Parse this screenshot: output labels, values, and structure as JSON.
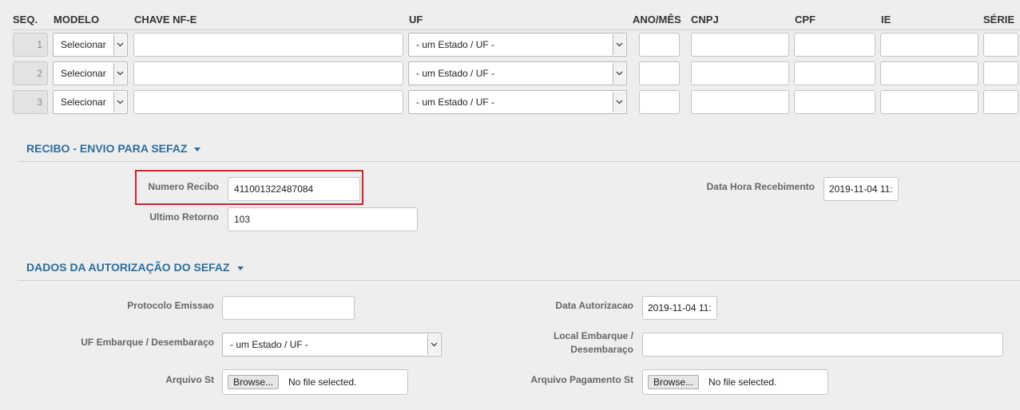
{
  "columns": {
    "seq": "SEQ.",
    "modelo": "MODELO",
    "chave": "CHAVE NF-E",
    "uf": "UF",
    "anomes": "ANO/MÊS",
    "cnpj": "CNPJ",
    "cpf": "CPF",
    "ie": "IE",
    "serie": "SÉRIE"
  },
  "rows": [
    {
      "seq": "1",
      "modelo": "Selecionar",
      "uf": "- um Estado / UF -"
    },
    {
      "seq": "2",
      "modelo": "Selecionar",
      "uf": "- um Estado / UF -"
    },
    {
      "seq": "3",
      "modelo": "Selecionar",
      "uf": "- um Estado / UF -"
    }
  ],
  "recibo": {
    "title": "RECIBO - ENVIO PARA SEFAZ",
    "numero_label": "Numero Recibo",
    "numero_value": "411001322487084",
    "ultimo_label": "Ultimo Retorno",
    "ultimo_value": "103",
    "data_label": "Data Hora Recebimento",
    "data_value": "2019-11-04 11:"
  },
  "autorizacao": {
    "title": "DADOS DA AUTORIZAÇÃO DO SEFAZ",
    "protocolo_label": "Protocolo Emissao",
    "protocolo_value": "",
    "data_label": "Data Autorizacao",
    "data_value": "2019-11-04 11:",
    "uf_label": "UF Embarque / Desembaraço",
    "uf_value": "- um Estado / UF -",
    "local_label_line1": "Local Embarque /",
    "local_label_line2": "Desembaraço",
    "local_value": "",
    "arquivo_st_label": "Arquivo St",
    "arquivo_pag_label": "Arquivo Pagamento St",
    "browse_label": "Browse...",
    "no_file_label": "No file selected."
  },
  "colors": {
    "section_title": "#2c6e9e",
    "highlight_border": "#d2232a",
    "background": "#eeeeee"
  }
}
